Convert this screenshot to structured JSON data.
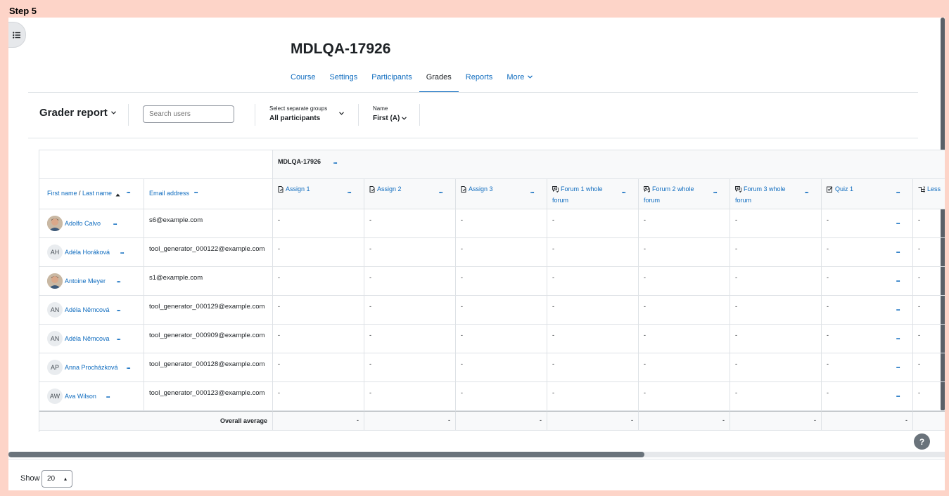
{
  "step_label": "Step 5",
  "course_title": "MDLQA-17926",
  "tabs": [
    {
      "label": "Course"
    },
    {
      "label": "Settings"
    },
    {
      "label": "Participants"
    },
    {
      "label": "Grades"
    },
    {
      "label": "Reports"
    },
    {
      "label": "More"
    }
  ],
  "active_tab": "Grades",
  "toolbar": {
    "report_title": "Grader report",
    "search_placeholder": "Search users",
    "group_label": "Select separate groups",
    "group_value": "All participants",
    "name_label": "Name",
    "name_value": "First (A)"
  },
  "table": {
    "category_header": "MDLQA-17926",
    "first_name_label": "First name",
    "name_separator": " / ",
    "last_name_label": "Last name",
    "email_header": "Email address",
    "columns": [
      {
        "label": "Assign 1",
        "icon": "assignment-icon"
      },
      {
        "label": "Assign 2",
        "icon": "assignment-icon"
      },
      {
        "label": "Assign 3",
        "icon": "assignment-icon"
      },
      {
        "label": "Forum 1 whole forum",
        "icon": "forum-icon"
      },
      {
        "label": "Forum 2 whole forum",
        "icon": "forum-icon"
      },
      {
        "label": "Forum 3 whole forum",
        "icon": "forum-icon"
      },
      {
        "label": "Quiz 1",
        "icon": "quiz-icon"
      },
      {
        "label": "Less",
        "icon": "lesson-icon"
      }
    ],
    "rows": [
      {
        "name": "Adolfo Calvo",
        "initials": "",
        "email": "s6@example.com",
        "grade": "-"
      },
      {
        "name": "Adéla Horáková",
        "initials": "AH",
        "email": "tool_generator_000122@example.com",
        "grade": "-"
      },
      {
        "name": "Antoine Meyer",
        "initials": "",
        "email": "s1@example.com",
        "grade": "-"
      },
      {
        "name": "Adéla Němcová",
        "initials": "AN",
        "email": "tool_generator_000129@example.com",
        "grade": "-"
      },
      {
        "name": "Adéla Němcova",
        "initials": "AN",
        "email": "tool_generator_000909@example.com",
        "grade": "-"
      },
      {
        "name": "Anna Procházková",
        "initials": "AP",
        "email": "tool_generator_000128@example.com",
        "grade": "-"
      },
      {
        "name": "Ava Wilson",
        "initials": "AW",
        "email": "tool_generator_000123@example.com",
        "grade": "-"
      }
    ],
    "overall_average_label": "Overall average",
    "overall_average_value": "-"
  },
  "footer": {
    "show_label": "Show",
    "per_page": "20",
    "help": "?"
  },
  "colors": {
    "accent": "#0f6cbf",
    "page_bg": "#fdd4c8"
  }
}
